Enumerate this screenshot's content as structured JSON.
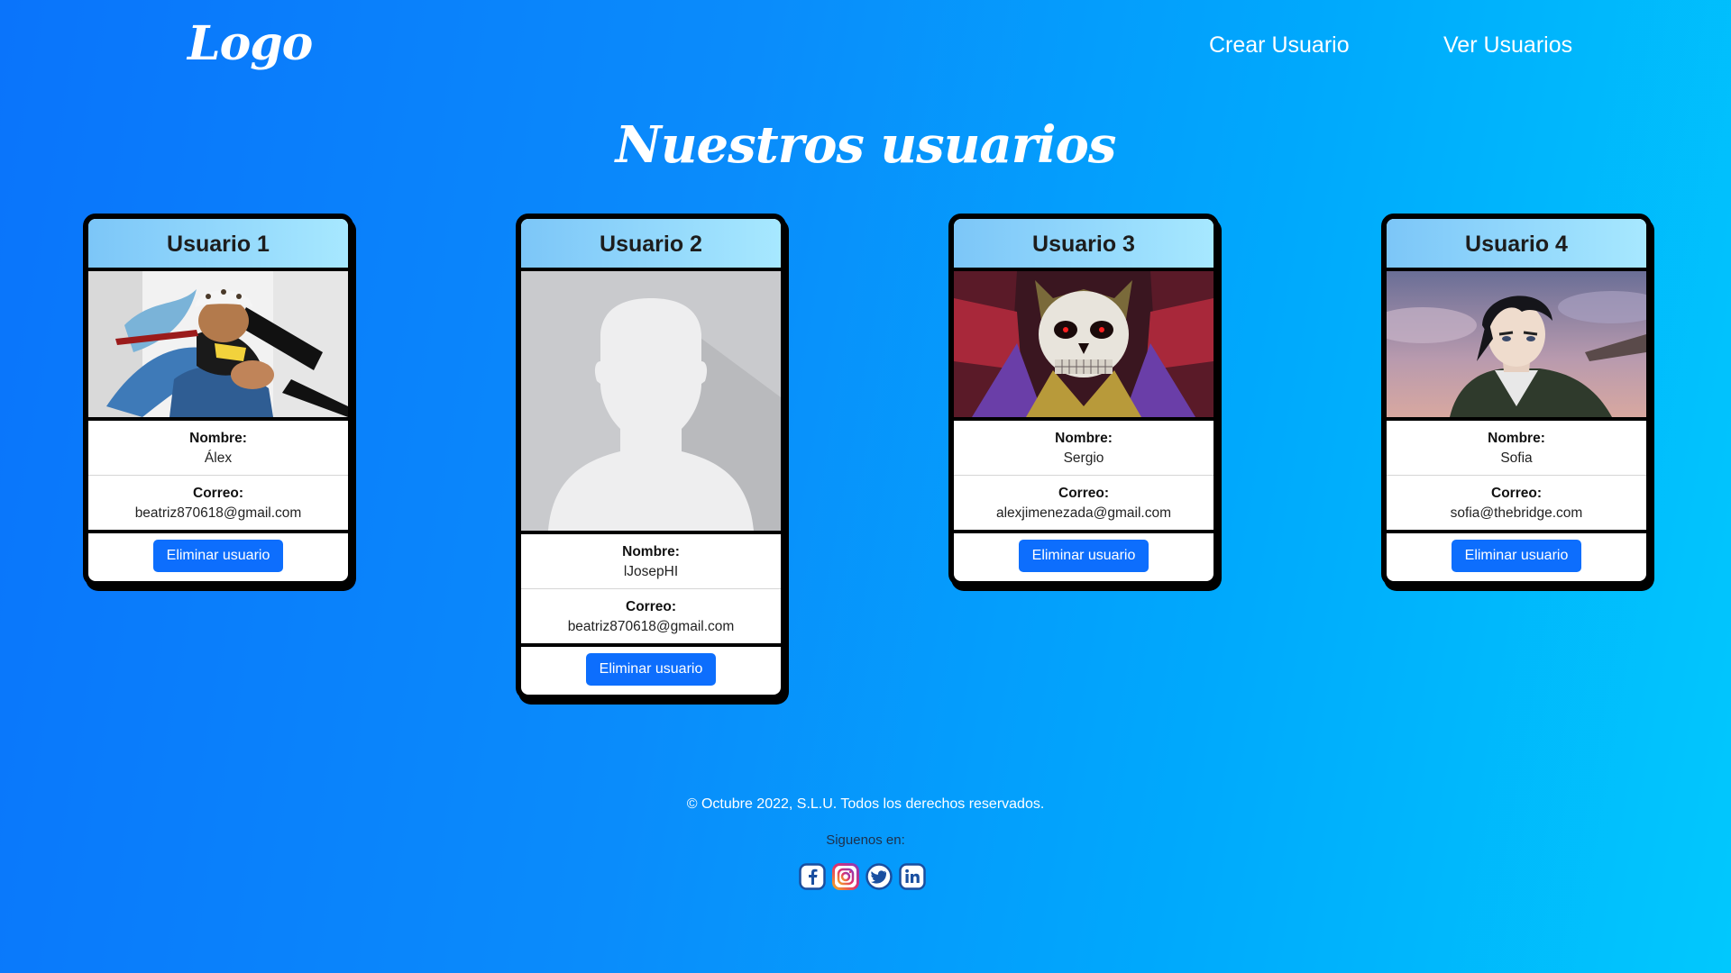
{
  "header": {
    "logo": "Logo",
    "nav": {
      "create_user": "Crear Usuario",
      "view_users": "Ver Usuarios"
    }
  },
  "main": {
    "title": "Nuestros usuarios",
    "field_labels": {
      "name": "Nombre:",
      "email": "Correo:"
    },
    "delete_label": "Eliminar usuario",
    "users": [
      {
        "title": "Usuario 1",
        "name": "Álex",
        "email": "beatriz870618@gmail.com",
        "avatar": "anime-character-with-hat-image"
      },
      {
        "title": "Usuario 2",
        "name": "lJosepHI",
        "email": "beatriz870618@gmail.com",
        "avatar": "default-person-placeholder"
      },
      {
        "title": "Usuario 3",
        "name": "Sergio",
        "email": "alexjimenezada@gmail.com",
        "avatar": "anime-skeleton-king-image"
      },
      {
        "title": "Usuario 4",
        "name": "Sofia",
        "email": "sofia@thebridge.com",
        "avatar": "anime-soldier-image"
      }
    ]
  },
  "footer": {
    "copyright": "© Octubre 2022, S.L.U. Todos los derechos reservados.",
    "follow": "Siguenos en:",
    "social": [
      "facebook-icon",
      "instagram-icon",
      "twitter-icon",
      "linkedin-icon"
    ]
  },
  "colors": {
    "primary_button": "#0d6efd",
    "background_start": "#0a74fb",
    "background_end": "#01c8fd",
    "card_header_start": "#7cc6f8",
    "card_header_end": "#a7e8ff"
  }
}
